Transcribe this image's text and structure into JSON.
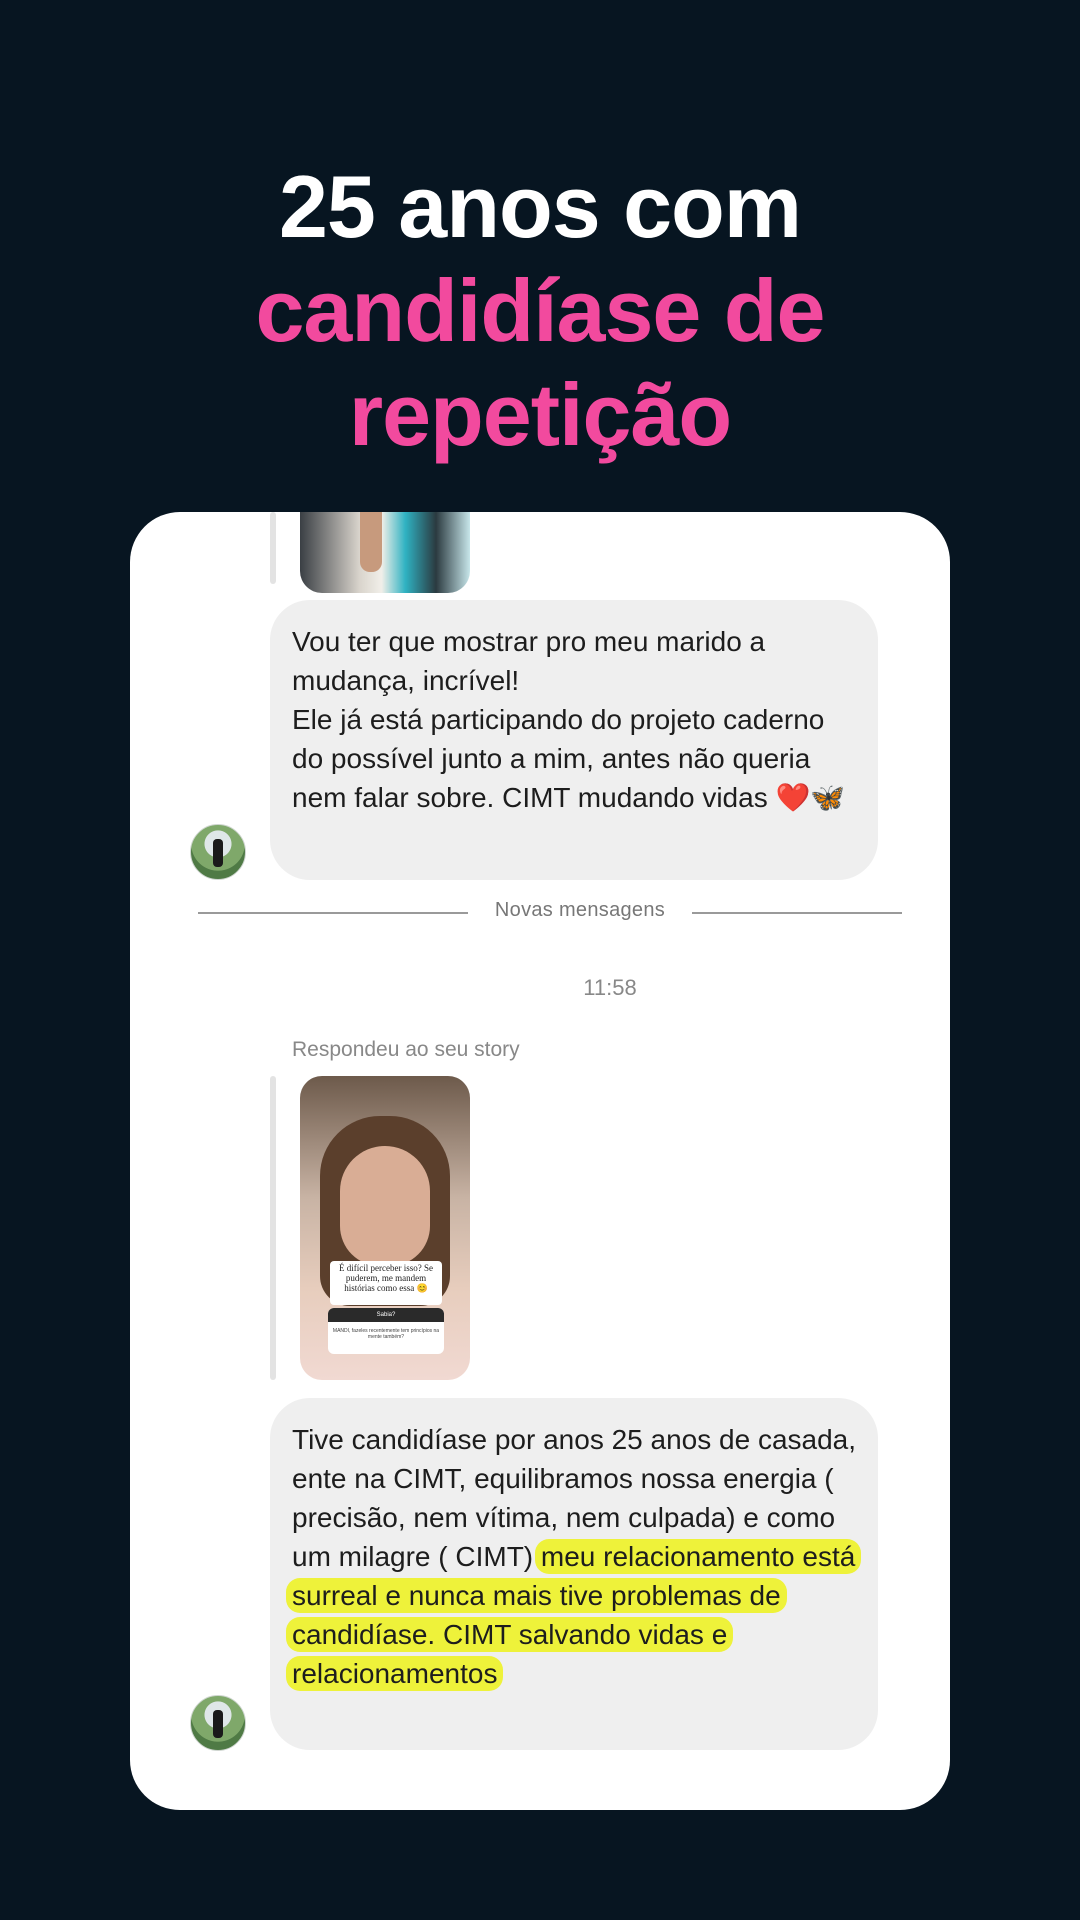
{
  "headline": {
    "line1": "25 anos com",
    "line2": "candidíase de",
    "line3": "repetição"
  },
  "colors": {
    "background": "#071521",
    "accent_pink": "#f24a9e",
    "highlight_yellow": "#eef23a"
  },
  "chat": {
    "message1": {
      "line_a": "Vou ter que mostrar pro meu marido a mudança, incrível!",
      "line_b": "Ele já está participando do projeto caderno do possível junto a mim, antes não queria nem falar sobre. CIMT mudando vidas ❤️🦋"
    },
    "divider_label": "Novas mensagens",
    "timestamp": "11:58",
    "reply_label": "Respondeu ao seu story",
    "story_sticker_text": "É difícil perceber isso? Se puderem, me mandem histórias como essa 😊",
    "story_question_header": "Sabia?",
    "story_question_text": "MANDI, fazeles recentemente tem princípios na mente também?",
    "message2": {
      "plain": "Tive candidíase por anos 25 anos de casada, ente na CIMT, equilibramos nossa energia ( precisão, nem vítima, nem culpada) e como um milagre ( CIMT) ",
      "highlighted": "meu relacionamento está surreal e nunca mais tive problemas de candidíase. CIMT salvando vidas e relacionamentos"
    }
  }
}
